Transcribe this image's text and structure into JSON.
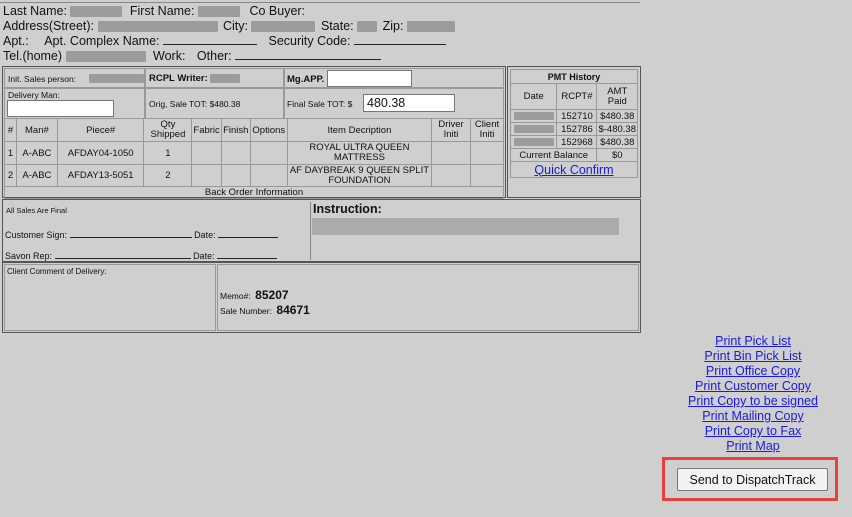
{
  "header": {
    "last_name_label": "Last Name:",
    "first_name_label": "First Name:",
    "co_buyer_label": "Co Buyer:",
    "address_label": "Address(Street):",
    "city_label": "City:",
    "state_label": "State:",
    "zip_label": "Zip:",
    "apt_label": "Apt.:",
    "apt_complex_label": "Apt. Complex Name:",
    "security_code_label": "Security Code:",
    "tel_home_label": "Tel.(home)",
    "work_label": "Work:",
    "other_label": "Other:"
  },
  "order": {
    "init_sales_label": "Init. Sales person:",
    "rcpl_writer_label": "RCPL Writer:",
    "mg_app_label": "Mg.APP.",
    "mg_app_value": "",
    "delivery_man_label": "Delivery Man:",
    "delivery_man_value": "",
    "orig_sale_label": "Orig, Sale TOT: $480.38",
    "final_sale_label": "Final Sale TOT: $",
    "final_sale_value": "480.38",
    "columns": [
      "#",
      "Man#",
      "Piece#",
      "Qty Shipped",
      "Fabric",
      "Finish",
      "Options",
      "Item Decription",
      "Driver Initi",
      "Client Initi"
    ],
    "rows": [
      {
        "num": "1",
        "man": "A-ABC",
        "piece": "AFDAY04-1050",
        "qty": "1",
        "desc": "ROYAL ULTRA QUEEN MATTRESS"
      },
      {
        "num": "2",
        "man": "A-ABC",
        "piece": "AFDAY13-5051",
        "qty": "2",
        "desc": "AF DAYBREAK 9 QUEEN SPLIT FOUNDATION"
      }
    ],
    "back_order_label": "Back Order Information"
  },
  "pmt": {
    "title": "PMT History",
    "columns": [
      "Date",
      "RCPT#",
      "AMT Paid"
    ],
    "rows": [
      {
        "rcpt": "152710",
        "amt": "$480.38"
      },
      {
        "rcpt": "152786",
        "amt": "$-480.38"
      },
      {
        "rcpt": "152968",
        "amt": "$480.38"
      }
    ],
    "balance_label": "Current Balance",
    "balance_value": "$0",
    "quick_confirm": "Quick Confirm"
  },
  "signoff": {
    "final_label": "All Sales Are Final",
    "customer_sign_label": "Customer Sign:",
    "savon_rep_label": "Savon Rep:",
    "date_label": "Date:",
    "instruction_label": "Instruction:",
    "client_comment_label": "Client Comment of Delivery:",
    "memo_label": "Memo#:",
    "memo_value": "85207",
    "sale_number_label": "Sale Number:",
    "sale_number_value": "84671"
  },
  "links": [
    "Print Pick List",
    "Print Bin Pick List",
    "Print Office Copy",
    "Print Customer Copy",
    "Print Copy to be signed",
    "Print Mailing Copy",
    "Print Copy to Fax",
    "Print Map"
  ],
  "send_button": "Send to DispatchTrack",
  "colors": {
    "highlight": "#e8403a",
    "link": "#1a1ae6",
    "background": "#cfcfcf"
  }
}
